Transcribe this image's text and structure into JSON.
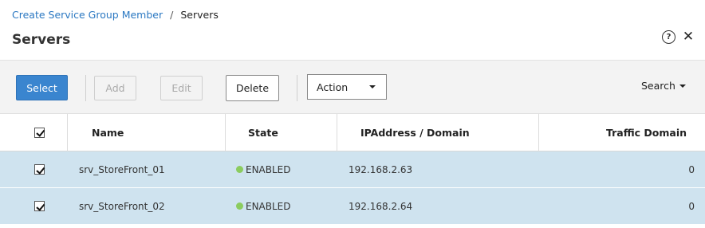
{
  "breadcrumb": {
    "parent": "Create Service Group Member",
    "separator": "/",
    "current": "Servers"
  },
  "page": {
    "title": "Servers"
  },
  "header_icons": {
    "help": "?",
    "close": "✕"
  },
  "toolbar": {
    "select_label": "Select",
    "add_label": "Add",
    "edit_label": "Edit",
    "delete_label": "Delete",
    "action_label": "Action",
    "search_label": "Search"
  },
  "table": {
    "columns": [
      "Name",
      "State",
      "IPAddress / Domain",
      "Traffic Domain"
    ],
    "rows": [
      {
        "checked": true,
        "name": "srv_StoreFront_01",
        "state": "ENABLED",
        "ip": "192.168.2.63",
        "traffic_domain": "0"
      },
      {
        "checked": true,
        "name": "srv_StoreFront_02",
        "state": "ENABLED",
        "ip": "192.168.2.64",
        "traffic_domain": "0"
      }
    ]
  },
  "colors": {
    "primary": "#3a85cf",
    "link": "#2b78c2",
    "selected_row": "#cfe3ef",
    "status_enabled": "#8bcc5f"
  }
}
